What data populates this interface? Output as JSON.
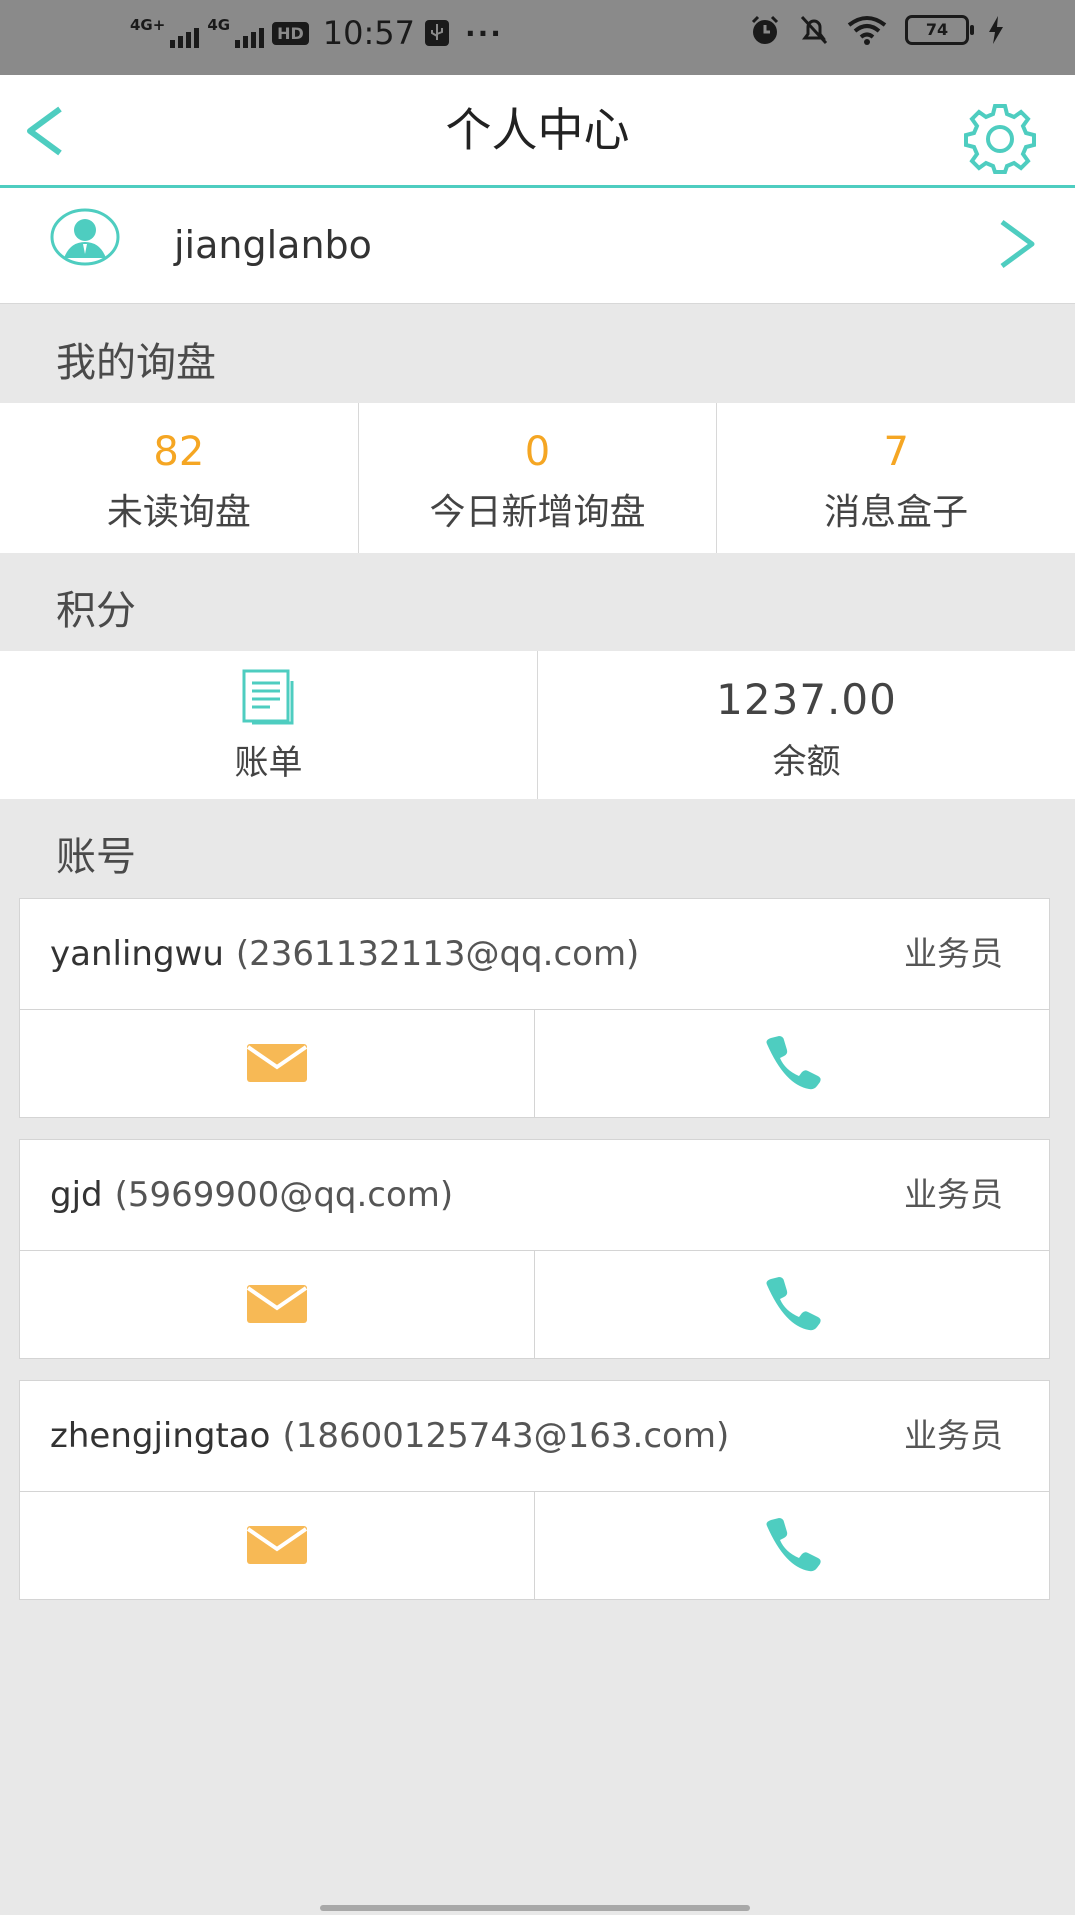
{
  "status_bar": {
    "network_1": "4G+",
    "network_2": "4G",
    "hd_label": "HD",
    "time": "10:57",
    "more": "···",
    "battery": "74"
  },
  "header": {
    "title": "个人中心",
    "back_icon": "chevron-left-icon",
    "settings_icon": "gear-icon"
  },
  "profile": {
    "username": "jianglanbo",
    "avatar_icon": "user-avatar-icon"
  },
  "inquiry": {
    "section_title": "我的询盘",
    "stats": [
      {
        "value": "82",
        "label": "未读询盘"
      },
      {
        "value": "0",
        "label": "今日新增询盘"
      },
      {
        "value": "7",
        "label": "消息盒子"
      }
    ]
  },
  "points": {
    "section_title": "积分",
    "bill_label": "账单",
    "balance_value": "1237.00",
    "balance_label": "余额"
  },
  "accounts": {
    "section_title": "账号",
    "items": [
      {
        "name": "yanlingwu",
        "email": "(2361132113@qq.com)",
        "role": "业务员"
      },
      {
        "name": "gjd",
        "email": "(5969900@qq.com)",
        "role": "业务员"
      },
      {
        "name": "zhengjingtao",
        "email": "(18600125743@163.com)",
        "role": "业务员"
      }
    ]
  },
  "colors": {
    "accent": "#4ecdc0",
    "number": "#f5a623",
    "mail": "#f7b955"
  }
}
